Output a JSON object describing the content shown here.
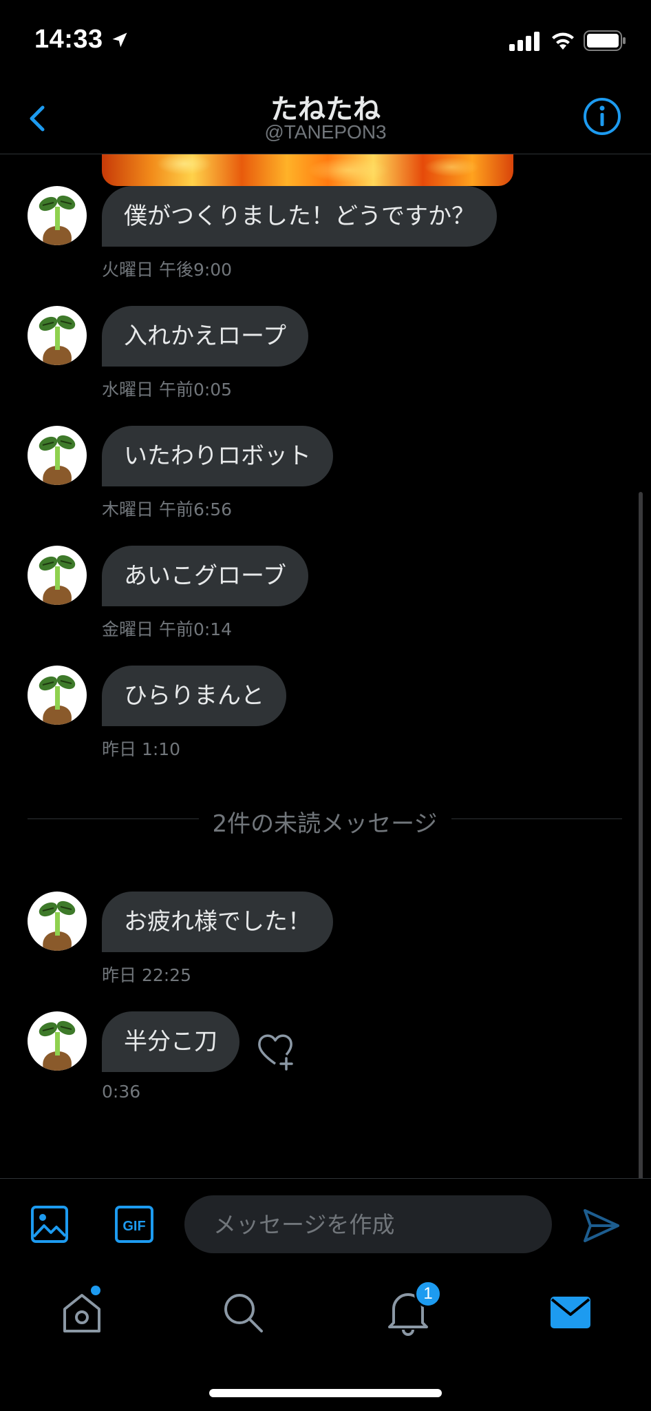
{
  "status_bar": {
    "time": "14:33"
  },
  "header": {
    "title": "たねたね",
    "handle": "@TANEPON3"
  },
  "messages": [
    {
      "text": "僕がつくりました！どうですか？",
      "time": "火曜日 午後9:00"
    },
    {
      "text": "入れかえロープ",
      "time": "水曜日 午前0:05"
    },
    {
      "text": "いたわりロボット",
      "time": "木曜日 午前6:56"
    },
    {
      "text": "あいこグローブ",
      "time": "金曜日 午前0:14"
    },
    {
      "text": "ひらりまんと",
      "time": "昨日 1:10"
    },
    {
      "text": "お疲れ様でした！",
      "time": "昨日 22:25"
    },
    {
      "text": "半分こ刀",
      "time": "0:36"
    }
  ],
  "unread_divider": "2件の未読メッセージ",
  "composer": {
    "placeholder": "メッセージを作成",
    "gif_label": "GIF"
  },
  "tabbar": {
    "notification_count": "1"
  },
  "colors": {
    "accent": "#1d9bf0",
    "bubble": "#2f3336",
    "background": "#000000"
  }
}
